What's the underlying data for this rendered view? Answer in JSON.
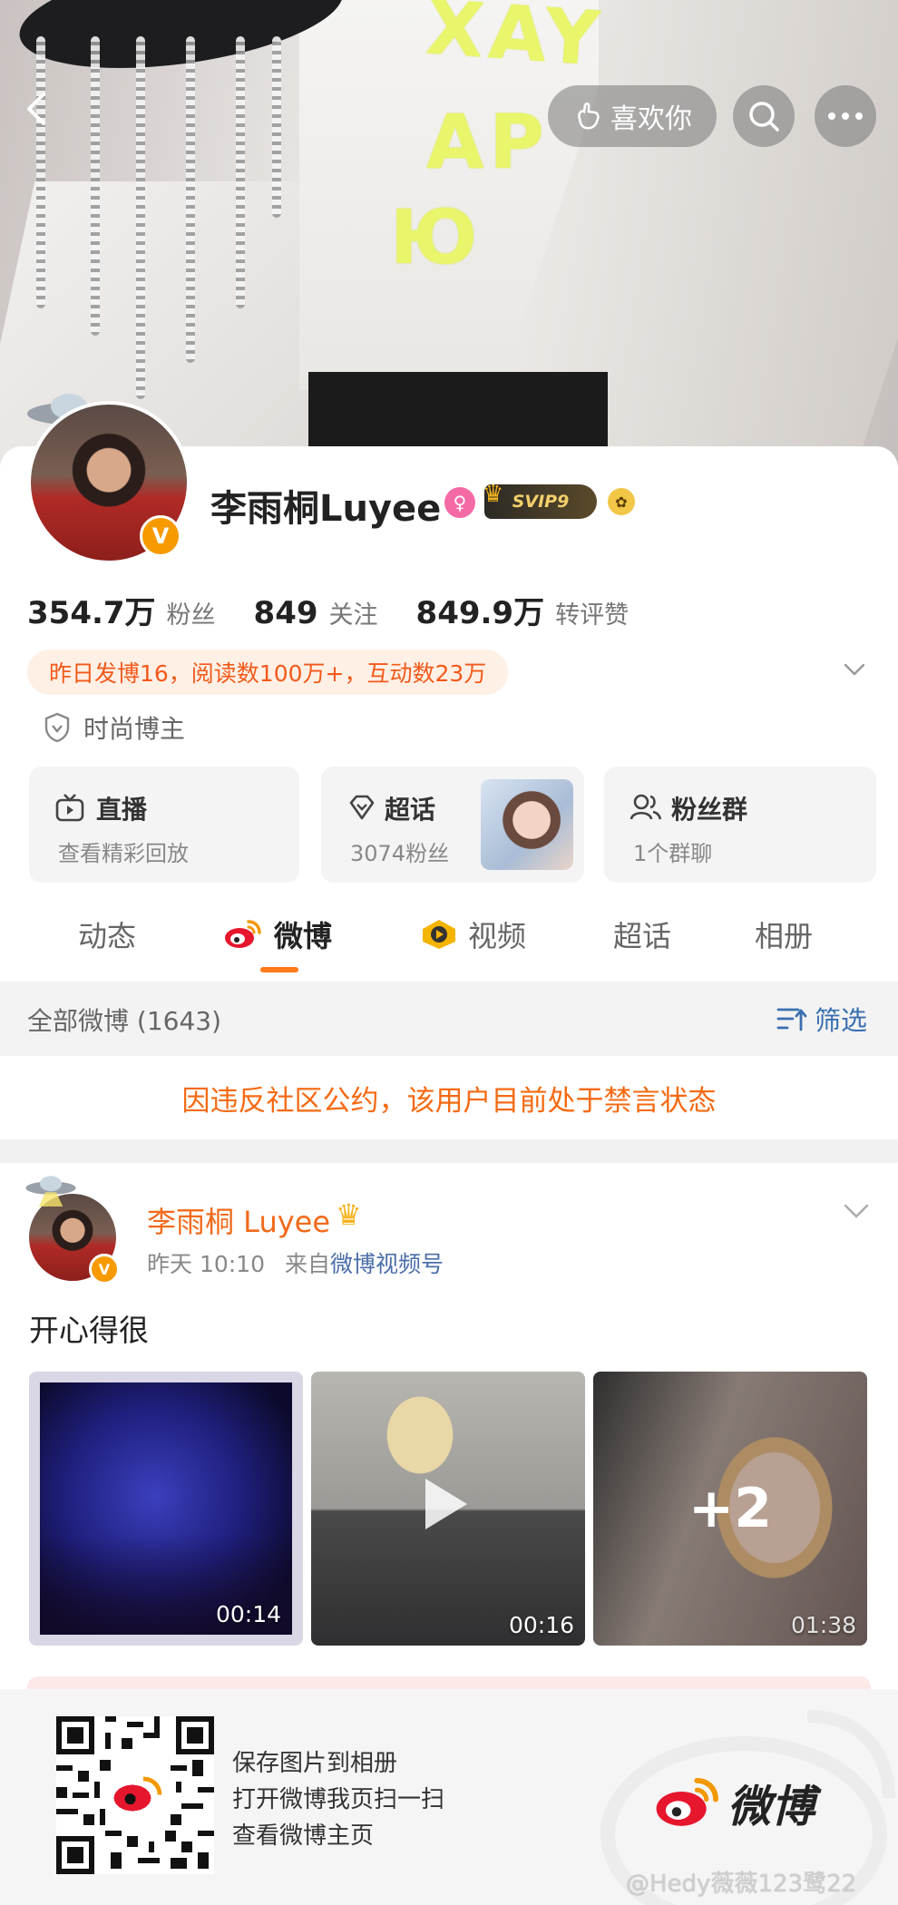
{
  "header": {
    "like_label": "喜欢你"
  },
  "profile": {
    "name": "李雨桐Luyee",
    "svip_label": "SVIP9",
    "stats": [
      {
        "num": "354.7万",
        "label": "粉丝"
      },
      {
        "num": "849",
        "label": "关注"
      },
      {
        "num": "849.9万",
        "label": "转评赞"
      }
    ],
    "banner": "昨日发博16，阅读数100万+，互动数23万",
    "tag": "时尚博主"
  },
  "tiles": [
    {
      "title": "直播",
      "sub": "查看精彩回放"
    },
    {
      "title": "超话",
      "sub": "3074粉丝"
    },
    {
      "title": "粉丝群",
      "sub": "1个群聊"
    }
  ],
  "tabs": [
    "动态",
    "微博",
    "视频",
    "超话",
    "相册"
  ],
  "list": {
    "title": "全部微博 (1643)",
    "filter_label": "筛选",
    "notice": "因违反社区公约，该用户目前处于禁言状态"
  },
  "post": {
    "author": "李雨桐 Luyee",
    "time": "昨天 10:10",
    "source_prefix": "来自",
    "source": "微博视频号",
    "text": "开心得很",
    "media": [
      {
        "duration": "00:14"
      },
      {
        "duration": "00:16"
      },
      {
        "duration": "01:38",
        "more": "+2"
      }
    ]
  },
  "share": {
    "lines": [
      "保存图片到相册",
      "打开微博我页扫一扫",
      "查看微博主页"
    ],
    "brand": "微博",
    "watermark": "@Hedy薇薇123鹭22"
  },
  "colors": {
    "accent": "#ff7a1a",
    "link": "#3a6fb0",
    "notice": "#f56a13"
  }
}
